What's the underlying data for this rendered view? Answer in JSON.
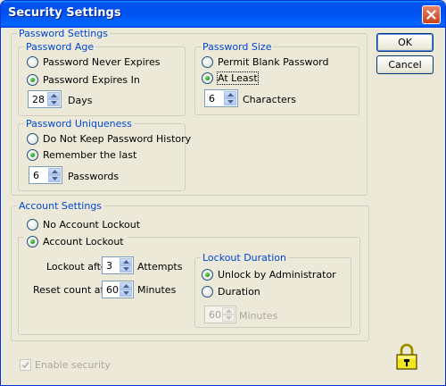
{
  "window": {
    "title": "Security Settings"
  },
  "buttons": {
    "ok": "OK",
    "cancel": "Cancel"
  },
  "password_settings": {
    "legend": "Password Settings",
    "age": {
      "legend": "Password Age",
      "never_expires": "Password Never Expires",
      "expires_in": "Password Expires In",
      "days_value": "28",
      "days_label": "Days",
      "selected": "expires_in"
    },
    "size": {
      "legend": "Password Size",
      "permit_blank": "Permit Blank Password",
      "at_least": "At Least",
      "chars_value": "6",
      "chars_label": "Characters",
      "selected": "at_least"
    },
    "uniqueness": {
      "legend": "Password Uniqueness",
      "no_history": "Do Not Keep Password History",
      "remember_last": "Remember the last",
      "count_value": "6",
      "count_label": "Passwords",
      "selected": "remember_last"
    }
  },
  "account_settings": {
    "legend": "Account Settings",
    "no_lockout": "No Account Lockout",
    "lockout": "Account Lockout",
    "selected": "lockout",
    "lockout_after_label": "Lockout after",
    "lockout_after_value": "3",
    "attempts_label": "Attempts",
    "reset_after_label": "Reset count after",
    "reset_after_value": "60",
    "minutes_label": "Minutes",
    "duration": {
      "legend": "Lockout Duration",
      "unlock_admin": "Unlock by Administrator",
      "duration": "Duration",
      "selected": "unlock_admin",
      "duration_value": "60",
      "minutes_label": "Minutes"
    }
  },
  "enable_security": {
    "label": "Enable security",
    "checked": true,
    "disabled": true
  },
  "icons": {
    "close": "close-icon",
    "lock": "lock-icon"
  },
  "colors": {
    "titlebar": "#0054e3",
    "legend": "#0046d5",
    "radio_check": "#21a121"
  }
}
